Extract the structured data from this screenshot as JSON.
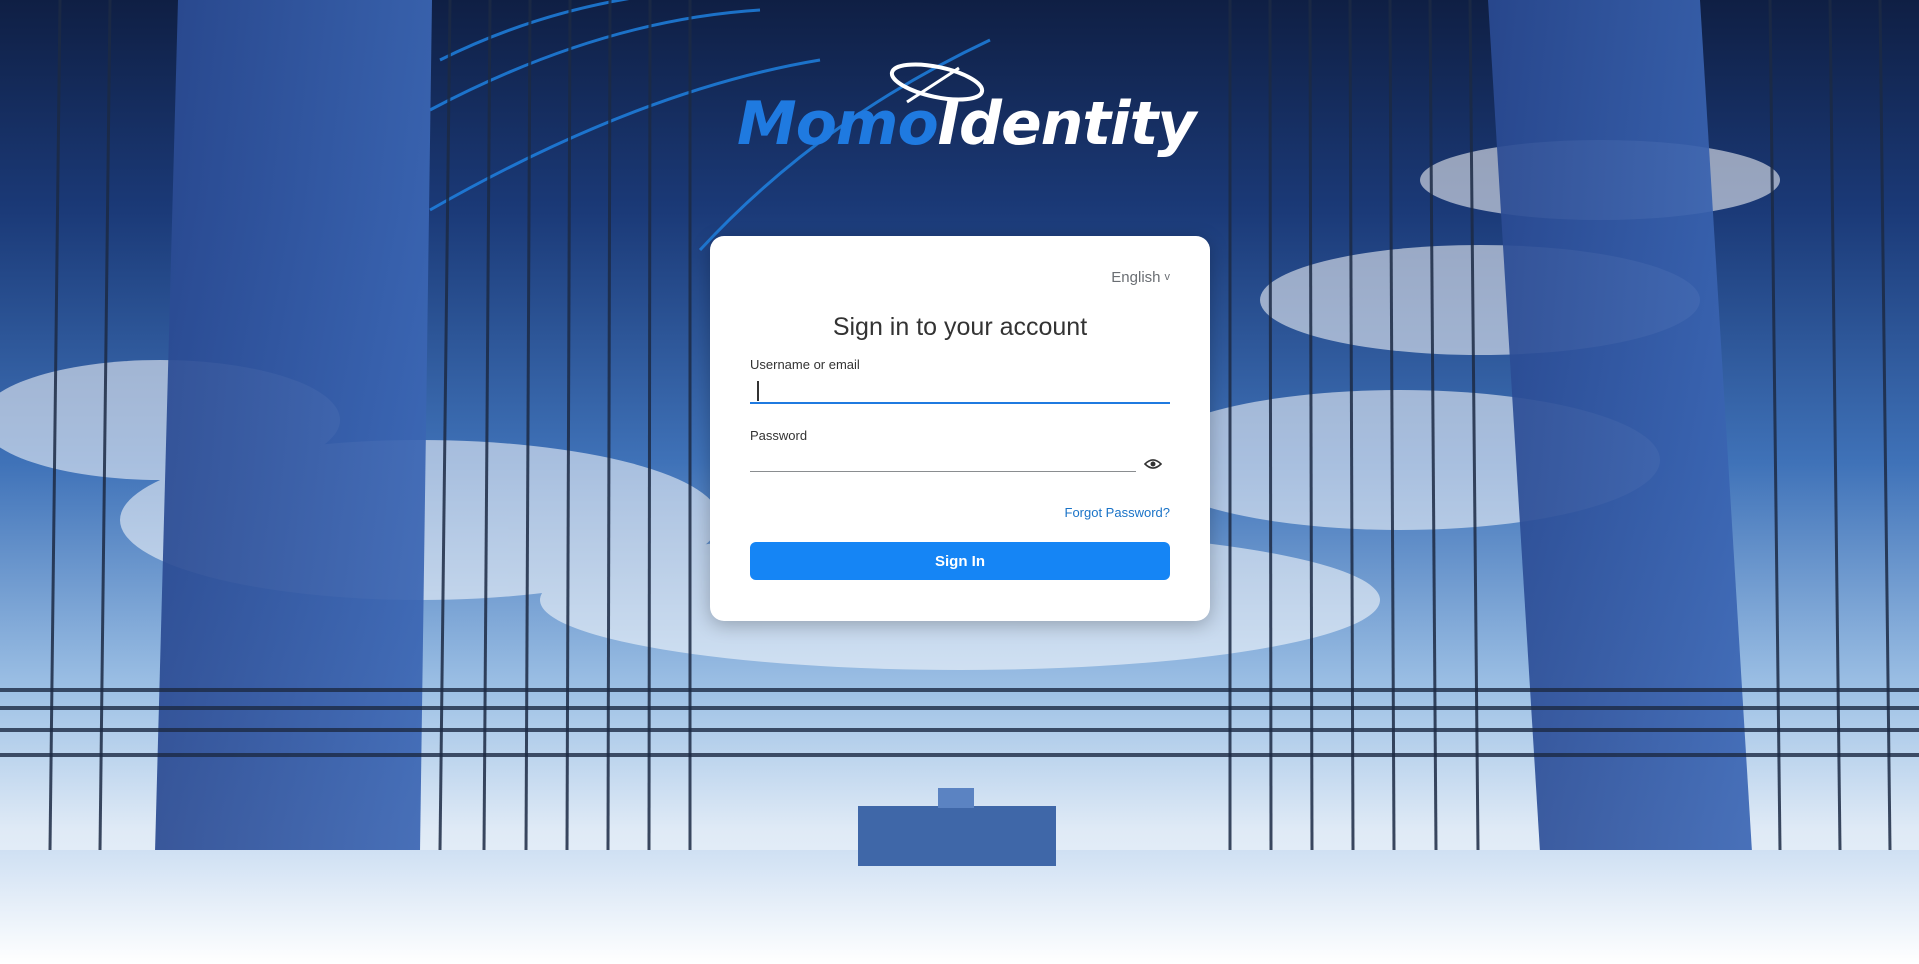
{
  "brand": {
    "logo_part1": "Momo",
    "logo_part2": "Identity"
  },
  "login": {
    "language_label": "English",
    "title": "Sign in to your account",
    "username_label": "Username or email",
    "username_value": "",
    "password_label": "Password",
    "password_value": "",
    "forgot_link": "Forgot Password?",
    "submit_label": "Sign In"
  },
  "colors": {
    "accent": "#1585f5",
    "link": "#1a73c7",
    "logo_blue": "#1f7ae0"
  },
  "icons": {
    "password_toggle": "eye-icon",
    "language_dropdown": "chevron-down-icon"
  }
}
